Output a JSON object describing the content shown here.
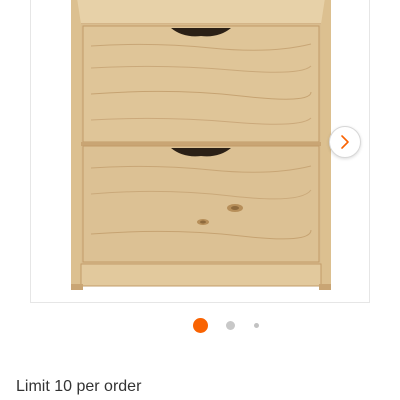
{
  "product_image": {
    "icon": "wooden-two-drawer-chest",
    "colors": {
      "wood": "#d9bd8f",
      "wood_light": "#e6cfa5",
      "grain": "#c49e6a",
      "handle_shadow": "#2b2016"
    }
  },
  "carousel": {
    "next_icon": "chevron-right-icon",
    "active_index": 0,
    "dot_count": 3,
    "colors": {
      "active": "#f96302",
      "inactive": "#c8c8c8",
      "inactive_small": "#c2c2c2",
      "chevron": "#f96302"
    }
  },
  "purchase_limit": {
    "text": "Limit 10 per order"
  }
}
